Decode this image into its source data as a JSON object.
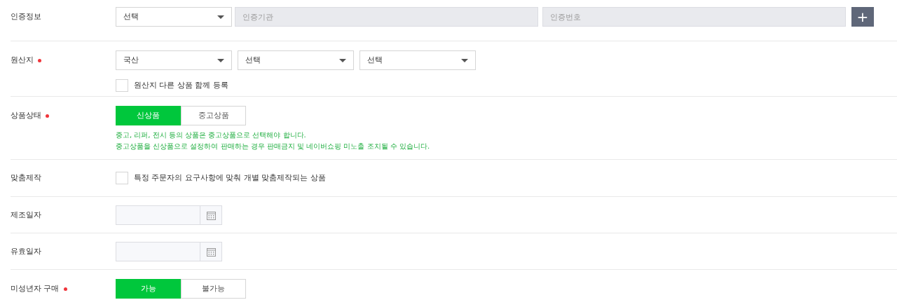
{
  "rows": [
    {
      "kind": "certification",
      "label": "인증정보",
      "required": false,
      "select": {
        "value": "선택"
      },
      "fields": [
        {
          "placeholder": "인증기관",
          "disabled": true
        },
        {
          "placeholder": "인증번호",
          "disabled": true
        }
      ],
      "add_button": "+"
    },
    {
      "kind": "origin",
      "label": "원산지",
      "required": true,
      "selects": [
        {
          "value": "국산"
        },
        {
          "value": "선택"
        },
        {
          "value": "선택"
        }
      ],
      "checkbox": {
        "label": "원산지 다른 상품 함께 등록",
        "checked": false
      }
    },
    {
      "kind": "toggle",
      "label": "상품상태",
      "required": true,
      "options": [
        {
          "label": "신상품",
          "selected": true
        },
        {
          "label": "중고상품",
          "selected": false
        }
      ],
      "notes": [
        "중고, 리퍼, 전시 등의 상품은 중고상품으로 선택해야 합니다.",
        "중고상품을 신상품으로 설정하여 판매하는 경우 판매금지 및 네이버쇼핑 미노출 조치될 수 있습니다."
      ]
    },
    {
      "kind": "checkbox",
      "label": "맞춤제작",
      "required": false,
      "checkbox": {
        "label": "특정 주문자의 요구사항에 맞춰 개별 맞춤제작되는 상품",
        "checked": false
      }
    },
    {
      "kind": "date",
      "label": "제조일자",
      "required": false
    },
    {
      "kind": "date",
      "label": "유효일자",
      "required": false
    },
    {
      "kind": "toggle",
      "label": "미성년자 구매",
      "required": true,
      "options": [
        {
          "label": "가능",
          "selected": true
        },
        {
          "label": "불가능",
          "selected": false
        }
      ]
    }
  ]
}
